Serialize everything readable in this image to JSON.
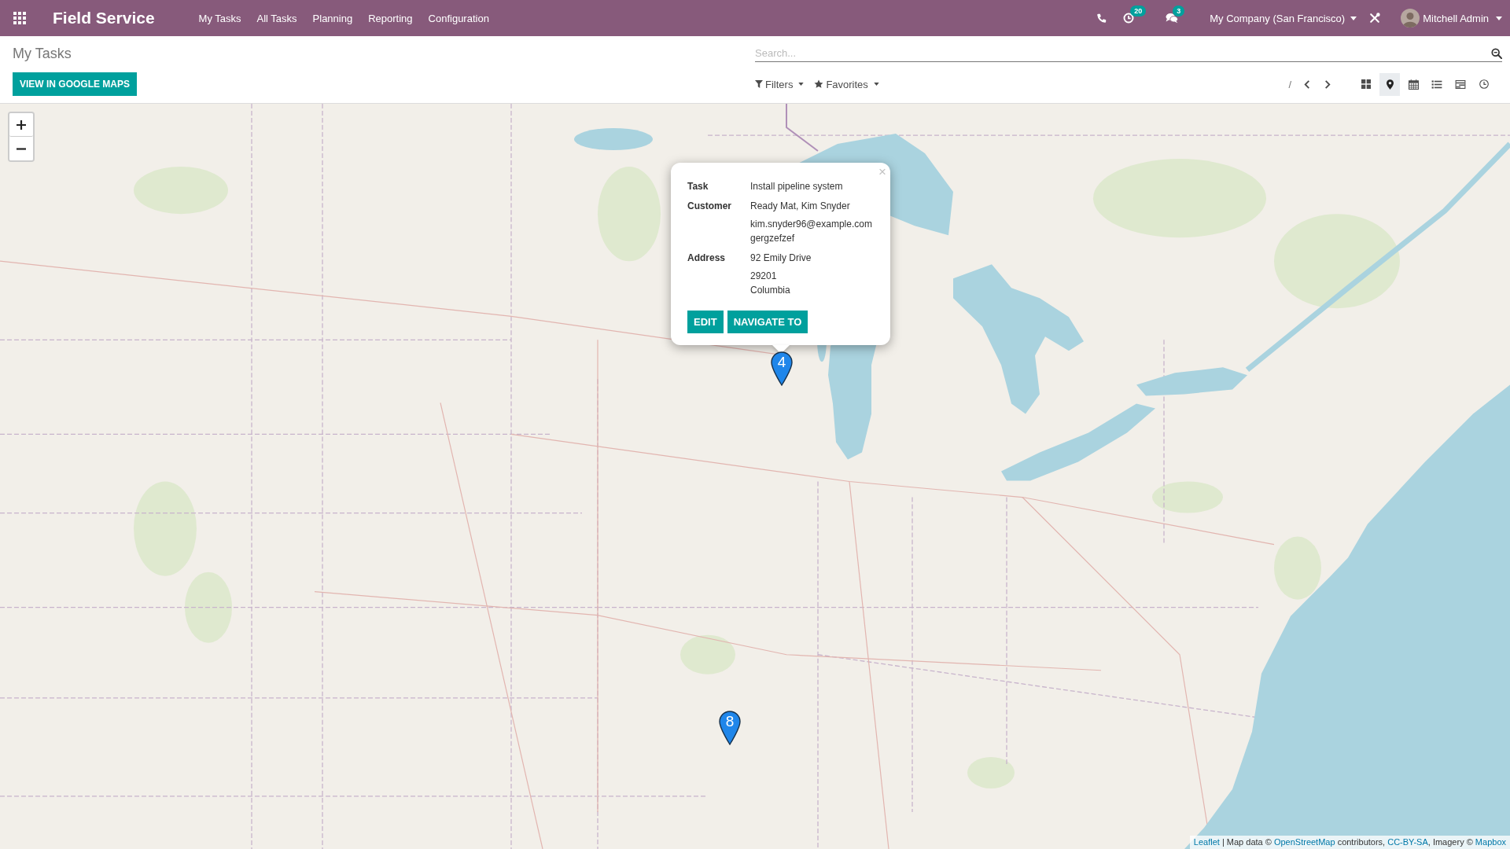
{
  "navbar": {
    "app_title": "Field Service",
    "menu": [
      {
        "label": "My Tasks"
      },
      {
        "label": "All Tasks"
      },
      {
        "label": "Planning"
      },
      {
        "label": "Reporting"
      },
      {
        "label": "Configuration"
      }
    ],
    "activity_badge": "20",
    "messages_badge": "3",
    "company": "My Company (San Francisco)",
    "user": "Mitchell Admin"
  },
  "control_panel": {
    "breadcrumb": "My Tasks",
    "search": {
      "placeholder": "Search..."
    },
    "primary_button": "VIEW IN GOOGLE MAPS",
    "filters": "Filters",
    "favorites": "Favorites",
    "pager": "/",
    "views": [
      {
        "kind": "kanban",
        "selected": false
      },
      {
        "kind": "map",
        "selected": true
      },
      {
        "kind": "calendar",
        "selected": false
      },
      {
        "kind": "list",
        "selected": false
      },
      {
        "kind": "gantt",
        "selected": false
      },
      {
        "kind": "activity",
        "selected": false
      }
    ]
  },
  "map": {
    "markers": [
      {
        "label": "4"
      },
      {
        "label": "8"
      }
    ],
    "popup": {
      "close": "×",
      "rows": [
        {
          "label": "Task",
          "groups": [
            [
              "Install pipeline system"
            ]
          ]
        },
        {
          "label": "Customer",
          "groups": [
            [
              "Ready Mat, Kim Snyder"
            ],
            [
              "kim.snyder96@example.com",
              "gergzefzef"
            ]
          ]
        },
        {
          "label": "Address",
          "groups": [
            [
              "92 Emily Drive"
            ],
            [
              "29201",
              "Columbia"
            ]
          ]
        }
      ],
      "buttons": [
        "EDIT",
        "NAVIGATE TO"
      ]
    },
    "attribution": [
      {
        "kind": "link",
        "text": "Leaflet"
      },
      {
        "kind": "text",
        "text": " | Map data © "
      },
      {
        "kind": "link",
        "text": "OpenStreetMap"
      },
      {
        "kind": "text",
        "text": " contributors, "
      },
      {
        "kind": "link",
        "text": "CC-BY-SA"
      },
      {
        "kind": "text",
        "text": ", Imagery © "
      },
      {
        "kind": "link",
        "text": "Mapbox"
      }
    ]
  }
}
